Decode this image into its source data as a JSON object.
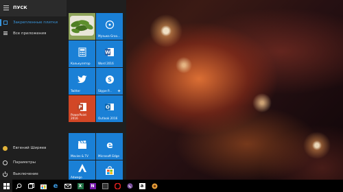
{
  "start_menu": {
    "title": "ПУСК",
    "nav": {
      "pinned_label": "Закрепленные плитки",
      "all_apps_label": "Все приложения"
    },
    "bottom": {
      "user_name": "Евгений Ширяев",
      "settings_label": "Параметры",
      "power_label": "Выключение"
    }
  },
  "tiles": {
    "photos": {
      "label": ""
    },
    "music": {
      "label": "Музыка Groo..."
    },
    "calculator": {
      "label": "Калькулятор"
    },
    "word": {
      "label": "Word 2016"
    },
    "twitter": {
      "label": "Twitter"
    },
    "skype": {
      "label": "Skype P..."
    },
    "powerpoint": {
      "label": "PowerPoint 2016"
    },
    "outlook": {
      "label": "Outlook 2016"
    },
    "movies": {
      "label": "Movies & TV"
    },
    "edge": {
      "label": "Microsoft Edge"
    },
    "adobe": {
      "label": "Adwego"
    },
    "store": {
      "label": ""
    }
  },
  "colors": {
    "accent": "#3a96dd",
    "tile_blue": "#1a80d6",
    "tile_orange": "#d24726",
    "menu_bg": "#1f1f1f",
    "taskbar_bg": "#000000"
  },
  "taskbar": {
    "icons": [
      "start-icon",
      "search-icon",
      "task-view-icon",
      "store-icon",
      "edge-icon",
      "mail-icon",
      "excel-icon",
      "onenote-icon",
      "terminal-icon",
      "opera-icon",
      "viber-icon",
      "amazon-icon",
      "pdf-icon"
    ]
  }
}
